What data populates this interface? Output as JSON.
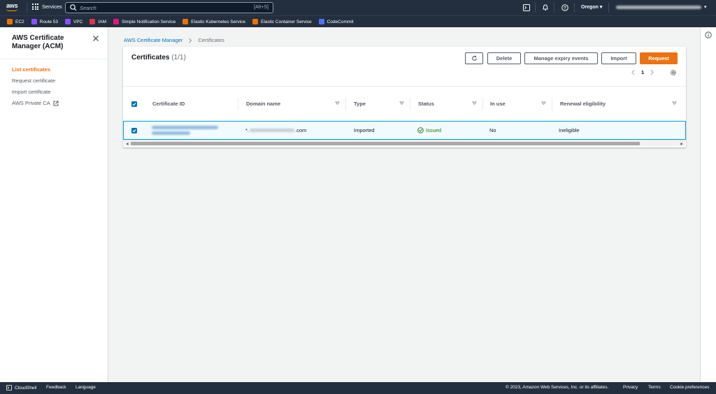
{
  "topnav": {
    "logo_text": "aws",
    "services_label": "Services",
    "search_placeholder": "Search",
    "search_shortcut": "[Alt+S]",
    "region_label": "Oregon ▾",
    "account_label": "▾"
  },
  "favorites": [
    {
      "label": "EC2",
      "color": "#ed7100",
      "icon": "ec2-icon"
    },
    {
      "label": "Route 53",
      "color": "#8c4fff",
      "icon": "route53-icon"
    },
    {
      "label": "VPC",
      "color": "#8c4fff",
      "icon": "vpc-icon"
    },
    {
      "label": "IAM",
      "color": "#dd344c",
      "icon": "iam-icon"
    },
    {
      "label": "Simple Notification Service",
      "color": "#e7157b",
      "icon": "sns-icon"
    },
    {
      "label": "Elastic Kubernetes Service",
      "color": "#ed7100",
      "icon": "eks-icon"
    },
    {
      "label": "Elastic Container Service",
      "color": "#ed7100",
      "icon": "ecs-icon"
    },
    {
      "label": "CodeCommit",
      "color": "#4d72f3",
      "icon": "codecommit-icon"
    }
  ],
  "sidenav": {
    "title": "AWS Certificate Manager (ACM)",
    "items": [
      {
        "label": "List certificates",
        "active": true
      },
      {
        "label": "Request certificate",
        "active": false
      },
      {
        "label": "Import certificate",
        "active": false
      },
      {
        "label": "AWS Private CA",
        "active": false,
        "external": true
      }
    ]
  },
  "breadcrumb": {
    "root": "AWS Certificate Manager",
    "current": "Certificates"
  },
  "panel": {
    "title": "Certificates",
    "count": "(1/1)",
    "buttons": {
      "delete": "Delete",
      "manage": "Manage expiry events",
      "import": "Import",
      "request": "Request"
    },
    "page": "1"
  },
  "table": {
    "columns": [
      "Certificate ID",
      "Domain name",
      "Type",
      "Status",
      "In use",
      "Renewal eligibility"
    ],
    "rows": [
      {
        "certificate_id": "",
        "domain_prefix": "*.",
        "domain_suffix": ".com",
        "type": "Imported",
        "status": "Issued",
        "in_use": "No",
        "renewal": "Ineligible"
      }
    ]
  },
  "footer": {
    "cloudshell": "CloudShell",
    "feedback": "Feedback",
    "language": "Language",
    "copyright": "© 2023, Amazon Web Services, Inc. or its affiliates.",
    "privacy": "Privacy",
    "terms": "Terms",
    "cookies": "Cookie preferences"
  },
  "colors": {
    "nav_bg": "#232f3e",
    "accent": "#ec7211",
    "link": "#0073bb",
    "success": "#1d8102"
  }
}
